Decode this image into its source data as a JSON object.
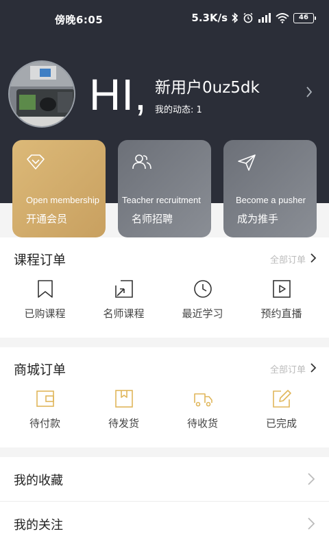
{
  "status_bar": {
    "time": "傍晚6:05",
    "network_speed": "5.3K/s",
    "battery": "46"
  },
  "profile": {
    "greeting": "HI,",
    "username": "新用户0uz5dk",
    "activity": "我的动态: 1"
  },
  "cards": [
    {
      "en": "Open membership",
      "cn": "开通会员",
      "icon": "diamond-icon",
      "color": "#d4b06e"
    },
    {
      "en": "Teacher recruitment",
      "cn": "名师招聘",
      "icon": "users-icon",
      "color": "#7b7f87"
    },
    {
      "en": "Become a pusher",
      "cn": "成为推手",
      "icon": "send-icon",
      "color": "#7b7f87"
    }
  ],
  "course_orders": {
    "title": "课程订单",
    "link": "全部订单",
    "items": [
      {
        "label": "已购课程",
        "icon": "bookmark-icon"
      },
      {
        "label": "名师课程",
        "icon": "external-box-icon"
      },
      {
        "label": "最近学习",
        "icon": "clock-icon"
      },
      {
        "label": "预约直播",
        "icon": "play-box-icon"
      }
    ]
  },
  "shop_orders": {
    "title": "商城订单",
    "link": "全部订单",
    "items": [
      {
        "label": "待付款",
        "icon": "wallet-icon"
      },
      {
        "label": "待发货",
        "icon": "package-icon"
      },
      {
        "label": "待收货",
        "icon": "truck-icon"
      },
      {
        "label": "已完成",
        "icon": "edit-icon"
      }
    ]
  },
  "list": [
    {
      "label": "我的收藏"
    },
    {
      "label": "我的关注"
    }
  ],
  "colors": {
    "header_bg": "#2b2e38",
    "gold_accent": "#e0b65a",
    "icon_dark": "#333333"
  }
}
